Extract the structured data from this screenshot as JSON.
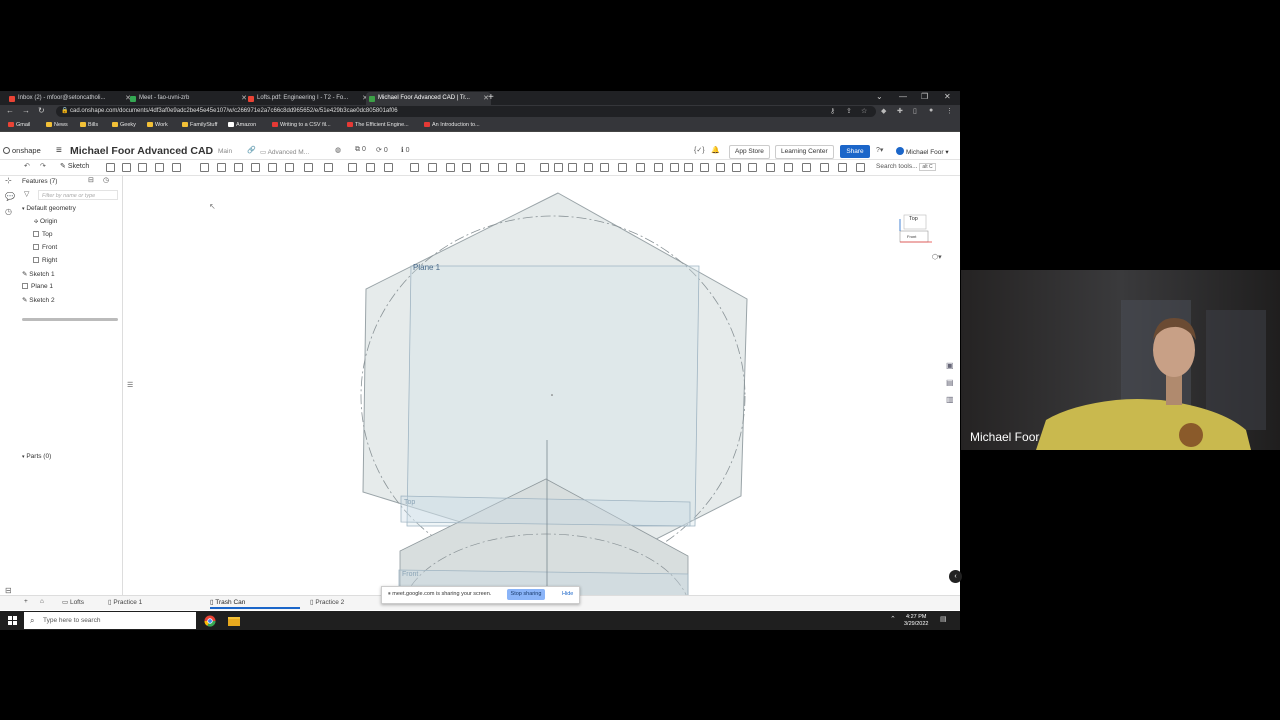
{
  "browser": {
    "tabs": [
      {
        "label": "Inbox (2) - mfoor@setoncatholi...",
        "color": "#ea4335"
      },
      {
        "label": "Meet - fao-uvni-zrb",
        "color": "#34a853"
      },
      {
        "label": "Lofts.pdf: Engineering I - T2 - Fo...",
        "color": "#ea4335"
      },
      {
        "label": "Michael Foor Advanced CAD | Tr...",
        "color": "#3ca046"
      }
    ],
    "url": "cad.onshape.com/documents/4df3af0e9adc2be45e45e107/w/c266971e2a7c66c8dd965652/e/51e429b3cae0dc805801af06",
    "bookmarks": [
      {
        "label": "Gmail",
        "color": "#ea4335"
      },
      {
        "label": "News",
        "color": "#f2c037"
      },
      {
        "label": "Bills",
        "color": "#f2c037"
      },
      {
        "label": "Geeky",
        "color": "#f2c037"
      },
      {
        "label": "Work",
        "color": "#f2c037"
      },
      {
        "label": "FamilyStuff",
        "color": "#f2c037"
      },
      {
        "label": "Amazon",
        "color": "#ffffff"
      },
      {
        "label": "Writing to a CSV fil...",
        "color": "#e53935"
      },
      {
        "label": "The Efficient Engine...",
        "color": "#e53935"
      },
      {
        "label": "An Introduction to...",
        "color": "#e53935"
      }
    ]
  },
  "onshape": {
    "logo": "onshape",
    "title": "Michael Foor Advanced CAD",
    "branch": "Main",
    "folder": "Advanced M...",
    "counts": [
      "0",
      "0",
      "0"
    ],
    "app_store": "App Store",
    "learning_center": "Learning Center",
    "share": "Share",
    "user": "Michael Foor",
    "sketch": "Sketch",
    "search_tools": "Search tools...",
    "search_hint": "alt C"
  },
  "features": {
    "header": "Features (7)",
    "filter_placeholder": "Filter by name or type",
    "default_geometry": "Default geometry",
    "items": [
      "Origin",
      "Top",
      "Front",
      "Right"
    ],
    "sketches": [
      "Sketch 1",
      "Plane 1",
      "Sketch 2"
    ],
    "parts": "Parts (0)"
  },
  "viewport": {
    "plane_label": "Plane 1",
    "top_label": "Top",
    "front_label": "Front",
    "viewcube_top": "Top",
    "viewcube_front": "Front"
  },
  "bottom_tabs": [
    "Lofts",
    "Practice 1",
    "Trash Can",
    "Practice 2"
  ],
  "screen_share": {
    "message": "meet.google.com is sharing your screen.",
    "stop": "Stop sharing",
    "hide": "Hide"
  },
  "taskbar": {
    "search": "Type here to search",
    "time": "4:27 PM",
    "date": "3/29/2022"
  },
  "webcam": {
    "name": "Michael Foor"
  }
}
